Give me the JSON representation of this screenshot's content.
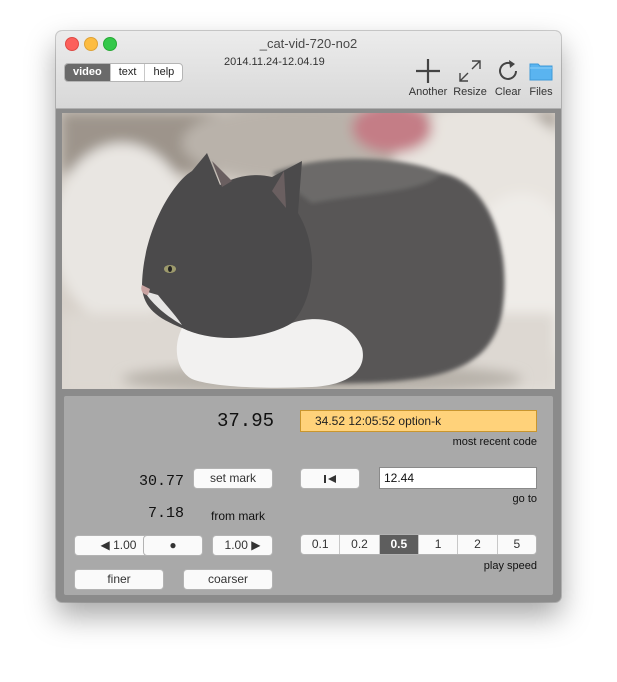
{
  "window": {
    "title": "_cat-vid-720-no2",
    "date_range": "2014.11.24-12.04.19"
  },
  "view_tabs": [
    {
      "label": "video",
      "active": true
    },
    {
      "label": "text",
      "active": false
    },
    {
      "label": "help",
      "active": false
    }
  ],
  "toolbar": {
    "another": {
      "label": "Another",
      "icon": "plus-icon"
    },
    "resize": {
      "label": "Resize",
      "icon": "resize-arrows-icon"
    },
    "clear": {
      "label": "Clear",
      "icon": "refresh-icon"
    },
    "files": {
      "label": "Files",
      "icon": "folder-icon"
    }
  },
  "controls": {
    "current_time": "37.95",
    "recent_code": "34.52  12:05:52  option-k",
    "recent_code_label": "most recent code",
    "mark_time": "30.77",
    "set_mark_label": "set mark",
    "from_mark_value": "7.18",
    "from_mark_label": "from mark",
    "goto_value": "12.44",
    "goto_label": "go to",
    "step_back_label": "◀ 1.00",
    "center_label": "●",
    "step_forward_label": "1.00 ▶",
    "finer_label": "finer",
    "coarser_label": "coarser",
    "speeds": [
      {
        "label": "0.1",
        "active": false
      },
      {
        "label": "0.2",
        "active": false
      },
      {
        "label": "0.5",
        "active": true
      },
      {
        "label": "1",
        "active": false
      },
      {
        "label": "2",
        "active": false
      },
      {
        "label": "5",
        "active": false
      }
    ],
    "play_speed_label": "play speed"
  },
  "colors": {
    "code_highlight": "#ffd27a",
    "selected_segment": "#5e5e5e",
    "folder_blue": "#5ab4f0"
  }
}
